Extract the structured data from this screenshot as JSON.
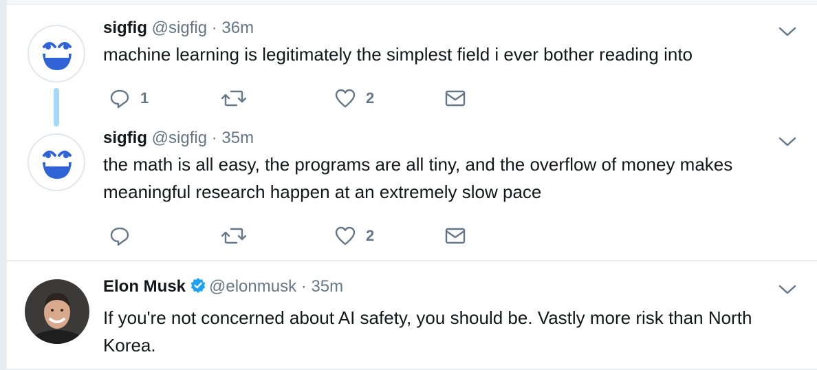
{
  "tweets": [
    {
      "name": "sigfig",
      "handle": "@sigfig",
      "separator": "·",
      "time": "36m",
      "text": "machine learning is legitimately the simplest field i ever bother reading into",
      "reply_count": "1",
      "retweet_count": "",
      "like_count": "2",
      "avatar_icon": "laughing-face-icon"
    },
    {
      "name": "sigfig",
      "handle": "@sigfig",
      "separator": "·",
      "time": "35m",
      "text": "the math is all easy, the programs are all tiny, and the overflow of money makes meaningful research happen at an extremely slow pace",
      "reply_count": "",
      "retweet_count": "",
      "like_count": "2",
      "avatar_icon": "laughing-face-icon"
    },
    {
      "name": "Elon Musk",
      "handle": "@elonmusk",
      "separator": "·",
      "time": "35m",
      "text": "If you're not concerned about AI safety, you should be. Vastly more risk than North Korea.",
      "verified": true,
      "avatar_icon": "profile-photo"
    }
  ],
  "colors": {
    "accent": "#1da1f2",
    "muted": "#657786",
    "thread_line": "#a4d9f9",
    "emoji_blue": "#2f63d6"
  }
}
